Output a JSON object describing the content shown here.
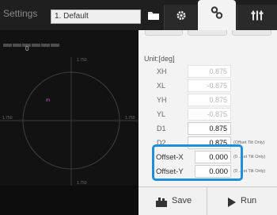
{
  "topbar": {
    "title": "Settings",
    "preset_value": "1. Default",
    "icons": {
      "folder": "folder-icon",
      "gear": "gear-icon",
      "keys": "key-pair-icon",
      "adjust": "adjust-icon"
    }
  },
  "left_panel": {
    "value": "0",
    "plot": {
      "scale_top": "1.750",
      "scale_bottom": "1.750",
      "scale_left": "1.750",
      "scale_right": "1.750",
      "marker": "m"
    }
  },
  "right_panel": {
    "unit_label": "Unit:[deg]",
    "params": [
      {
        "label": "XH",
        "value": "0.875",
        "active": false,
        "note": ""
      },
      {
        "label": "XL",
        "value": "-0.875",
        "active": false,
        "note": ""
      },
      {
        "label": "YH",
        "value": "0.875",
        "active": false,
        "note": ""
      },
      {
        "label": "YL",
        "value": "-0.875",
        "active": false,
        "note": ""
      },
      {
        "label": "D1",
        "value": "0.875",
        "active": true,
        "note": ""
      },
      {
        "label": "D2",
        "value": "0.875",
        "active": true,
        "note": "(Offset Tilt Only)"
      }
    ],
    "offsets": [
      {
        "label": "Offset-X",
        "value": "0.000",
        "note": "(0 ... et Tilt Only)"
      },
      {
        "label": "Offset-Y",
        "value": "0.000",
        "note": "(0 ... et Tilt Only)"
      }
    ]
  },
  "buttons": {
    "save_label": "Save",
    "run_label": "Run"
  },
  "colors": {
    "highlight": "#1e90d9",
    "dark_bg": "#1b1b1b",
    "light_bg": "#f3f3f3"
  }
}
